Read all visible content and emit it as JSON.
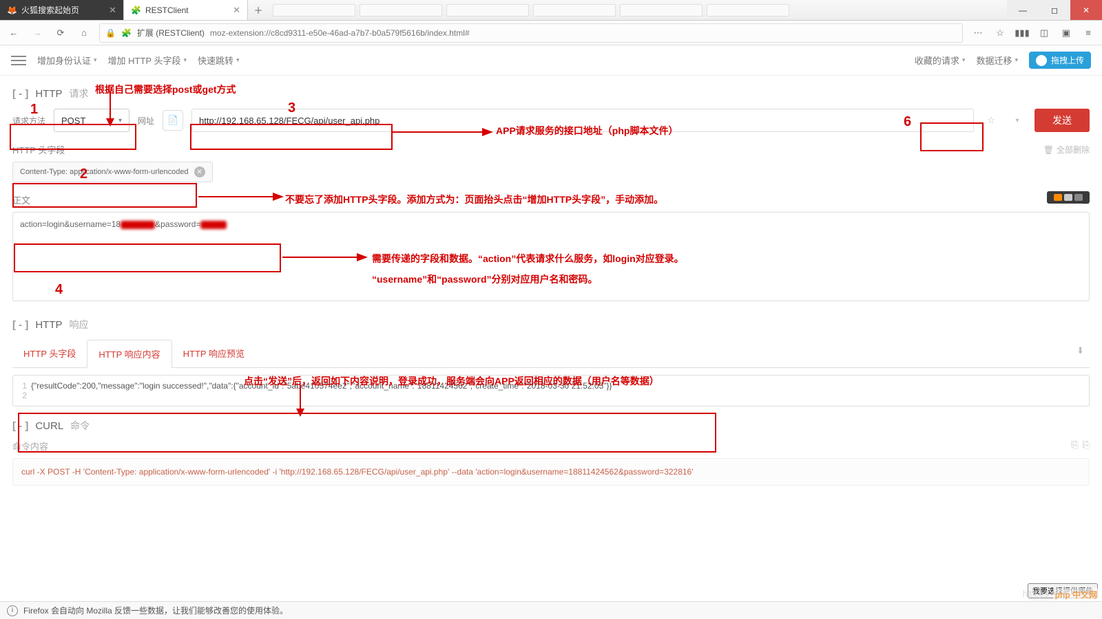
{
  "browser": {
    "tab1_title": "火狐搜索起始页",
    "tab2_title": "RESTClient",
    "addr_label": "扩展 (RESTClient)",
    "url": "moz-extension://c8cd9311-e50e-46ad-a7b7-b0a579f5616b/index.html#"
  },
  "toolbar": {
    "auth": "增加身份认证",
    "headers": "增加 HTTP 头字段",
    "quick": "快速跳转",
    "fav": "收藏的请求",
    "migrate": "数据迁移",
    "upload": "拖拽上传"
  },
  "request": {
    "section_label": "HTTP",
    "section_sub": "请求",
    "method_label": "请求方法",
    "method_value": "POST",
    "url_label": "网址",
    "url_value": "http://192.168.65.128/FECG/api/user_api.php",
    "send": "发送"
  },
  "headers": {
    "title": "HTTP 头字段",
    "clear": "全部删除",
    "chip": "Content-Type: application/x-www-form-urlencoded"
  },
  "body": {
    "label": "正文",
    "value_prefix": "action=login&username=18",
    "value_suffix": "&password="
  },
  "response": {
    "section_label": "HTTP",
    "section_sub": "响应",
    "tab1": "HTTP 头字段",
    "tab2": "HTTP 响应内容",
    "tab3": "HTTP 响应预览",
    "line1": "",
    "line2": "{\"resultCode\":200,\"message\":\"login successed!\",\"data\":{\"account_id\":\"5abe410574ee2\",\"account_name\":\"18811424562\",\"create_time\":\"2018-03-30 21:52:05\"}}"
  },
  "curl": {
    "section_label": "CURL",
    "section_sub": "命令",
    "label": "命令内容",
    "value": "curl -X POST -H 'Content-Type: application/x-www-form-urlencoded' -i 'http://192.168.65.128/FECG/api/user_api.php' --data 'action=login&username=18811424562&password=322816'"
  },
  "status": {
    "text": "Firefox 会自动向 Mozilla 反馈一些数据，让我们能够改善您的使用体验。",
    "privacy_btn": "我要选择提供哪些"
  },
  "annotations": {
    "n1": "1",
    "n2": "2",
    "n3": "3",
    "n4": "4",
    "n6": "6",
    "t1": "根据自己需要选择post或get方式",
    "t3": "APP请求服务的接口地址（php脚本文件）",
    "t2": "不要忘了添加HTTP头字段。添加方式为：页面抬头点击“增加HTTP头字段”，手动添加。",
    "t4a": "需要传递的字段和数据。“action”代表请求什么服务，如login对应登录。",
    "t4b": "“username”和“password”分别对应用户名和密码。",
    "t5": "点击“发送”后，返回如下内容说明，登录成功，服务端会向APP返回相应的数据（用户名等数据）"
  },
  "footer": {
    "watermark": "https://blog.c",
    "brand": "php 中文网"
  }
}
